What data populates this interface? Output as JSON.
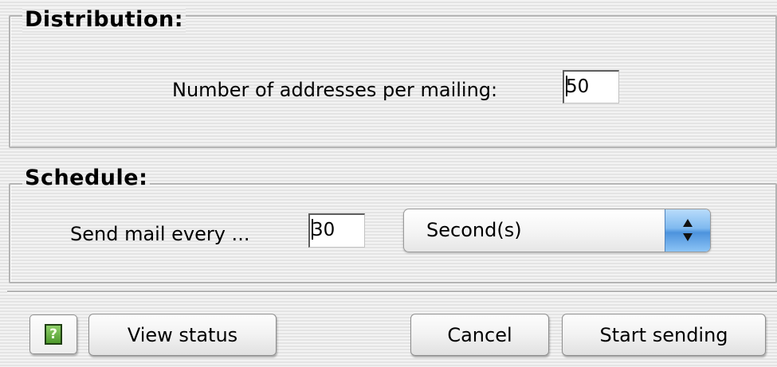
{
  "distribution": {
    "title": "Distribution:",
    "addresses_label": "Number of addresses per mailing:",
    "addresses_value": "50"
  },
  "schedule": {
    "title": "Schedule:",
    "send_label": "Send mail every ...",
    "interval_value": "30",
    "unit_selected": "Second(s)"
  },
  "buttons": {
    "help_glyph": "?",
    "view_status": "View status",
    "cancel": "Cancel",
    "start_sending": "Start sending"
  },
  "icons": {
    "help": "help-icon",
    "popup_arrows": "up-down-arrows-icon"
  },
  "colors": {
    "popup_accent": "#6aaeea",
    "help_icon": "#5fa83a"
  }
}
